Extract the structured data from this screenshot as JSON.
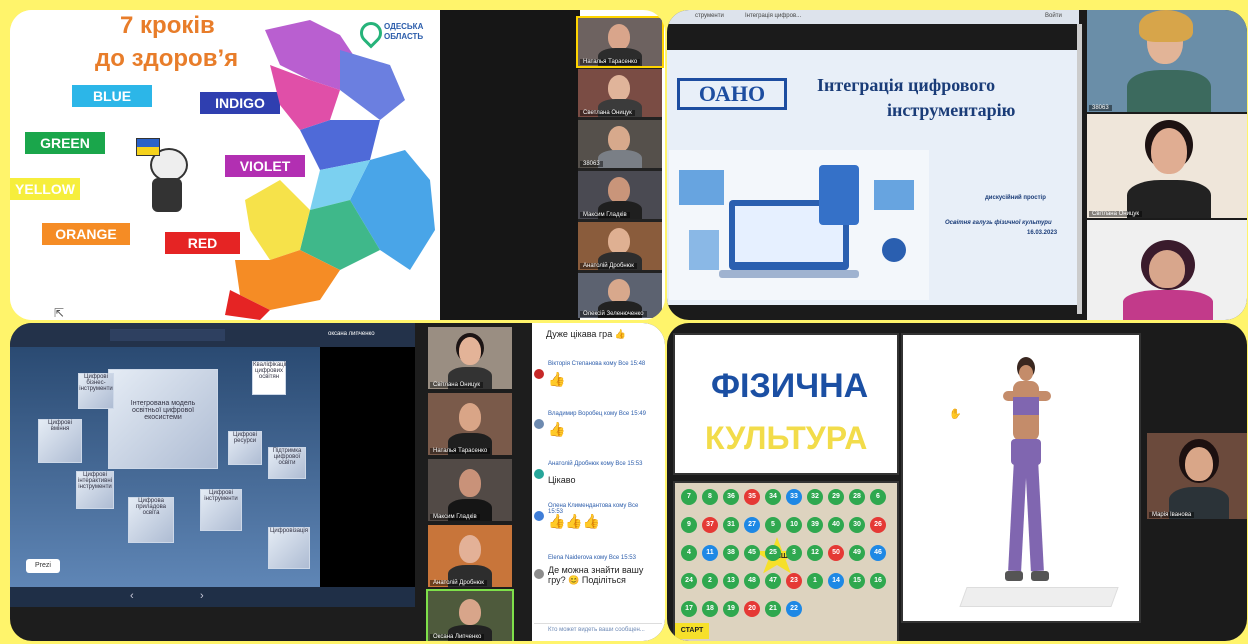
{
  "panel1": {
    "title_line1": "7 кроків",
    "title_line2": "до здоров’я",
    "logo_line1": "ОДЕСЬКА",
    "logo_line2": "ОБЛАСТЬ",
    "colors": {
      "blue": {
        "label": "BLUE",
        "color": "#2cb6e8"
      },
      "indigo": {
        "label": "INDIGO",
        "color": "#2f3fb0"
      },
      "green": {
        "label": "GREEN",
        "color": "#1aa64b"
      },
      "violet": {
        "label": "VIOLET",
        "color": "#b22fb2"
      },
      "yellow": {
        "label": "YELLOW",
        "color": "#f6ee3c"
      },
      "orange": {
        "label": "ORANGE",
        "color": "#f58c25"
      },
      "red": {
        "label": "RED",
        "color": "#e52424"
      }
    },
    "participants": [
      "Наталья Тарасенко",
      "Светлана Оницук",
      "38063",
      "Максим Гладків",
      "Анатолій Дробнюк",
      "Олексій Зеленюченко"
    ]
  },
  "panel2": {
    "tab1": "струменти",
    "tab2": "Інтеграція цифров...",
    "signin": "Войти",
    "logo": "ОАНО",
    "heading_line1": "Інтеграція цифрового",
    "heading_line2": "інструментарію",
    "sub1": "дискусійний простір",
    "sub2": "Освітня галузь фізичної культури",
    "date": "16.03.2023",
    "participants": [
      "38063",
      "Світлана Оницук",
      ""
    ]
  },
  "panel3": {
    "header_user": "оксана липченко",
    "center_box_line1": "Інтегрована модель",
    "center_box_line2": "освітньої цифрової",
    "center_box_line3": "екосистеми",
    "boxes": [
      "Цифрові бізнес-інструменти",
      "Цифрові вміння",
      "Цифрові ресурси",
      "Цифрові інтерактивні інструменти",
      "Цифрова приладова освіта",
      "Цифрові інструменти",
      "Підтримка цифрової освіти",
      "Цифровізація",
      "Кваліфікації цифрових освітян"
    ],
    "prezi": "Prezi",
    "participants": [
      "Світлана Оницук",
      "Наталья Тарасенко",
      "Максим Гладків",
      "Анатолій Дробнюк",
      "Оксана Липченко"
    ],
    "chat": [
      {
        "name": "",
        "text": "Дуже цікава гра 👍"
      },
      {
        "name": "Вікторія Степанова кому Все 15:48",
        "text": "👍"
      },
      {
        "name": "Владимир Воробец кому Все 15:49",
        "text": "👍"
      },
      {
        "name": "Анатолій Дробнюк кому Все 15:53",
        "text": "Цікаво"
      },
      {
        "name": "Олена Климендантова кому Все 15:53",
        "text": "👍👍👍"
      },
      {
        "name": "Elena Naiderova кому Все 15:53",
        "text": "Де можна знайти вашу гру? 😊 Поділіться"
      }
    ],
    "chat_input_placeholder": "Кто может видеть ваши сообщен..."
  },
  "panel4": {
    "title1": "ФІЗИЧНА",
    "title2": "КУЛЬТУРА",
    "finish": "ФІНІШ",
    "start": "СТАРТ",
    "participant": "Марія Іванова",
    "balls": [
      "7",
      "8",
      "36",
      "35",
      "34",
      "33",
      "32",
      "29",
      "28",
      "6",
      "9",
      "37",
      "31",
      "27",
      "5",
      "10",
      "39",
      "40",
      "30",
      "26",
      "4",
      "11",
      "38",
      "45",
      "25",
      "3",
      "12",
      "50",
      "49",
      "46",
      "24",
      "2",
      "13",
      "48",
      "47",
      "23",
      "1",
      "14",
      "15",
      "16",
      "17",
      "18",
      "19",
      "20",
      "21",
      "22"
    ]
  }
}
